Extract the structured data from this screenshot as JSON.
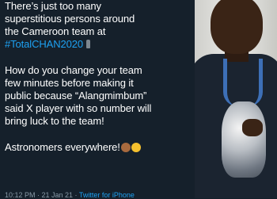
{
  "tweet": {
    "lines_p1": [
      "There’s just too many",
      "superstitious persons around",
      "the Cameroon team at"
    ],
    "hashtag": "#TotalCHAN2020",
    "lines_p2": [
      "How do you change your team",
      "few minutes before making it",
      "public because “Alangmimbum”",
      "said X player with so number will",
      "bring luck to the team!"
    ],
    "closing": "Astronomers everywhere!",
    "meta_time": "10:12 PM · 21 Jan 21 · ",
    "meta_source": "Twitter for iPhone"
  },
  "icons": {
    "after_hashtag": "person-standing-icon",
    "closing_1": "person-facepalming-icon",
    "closing_2": "tired-face-icon"
  },
  "colors": {
    "background": "#15202b",
    "text": "#ffffff",
    "link": "#1da1f2",
    "meta": "#8899a6"
  }
}
